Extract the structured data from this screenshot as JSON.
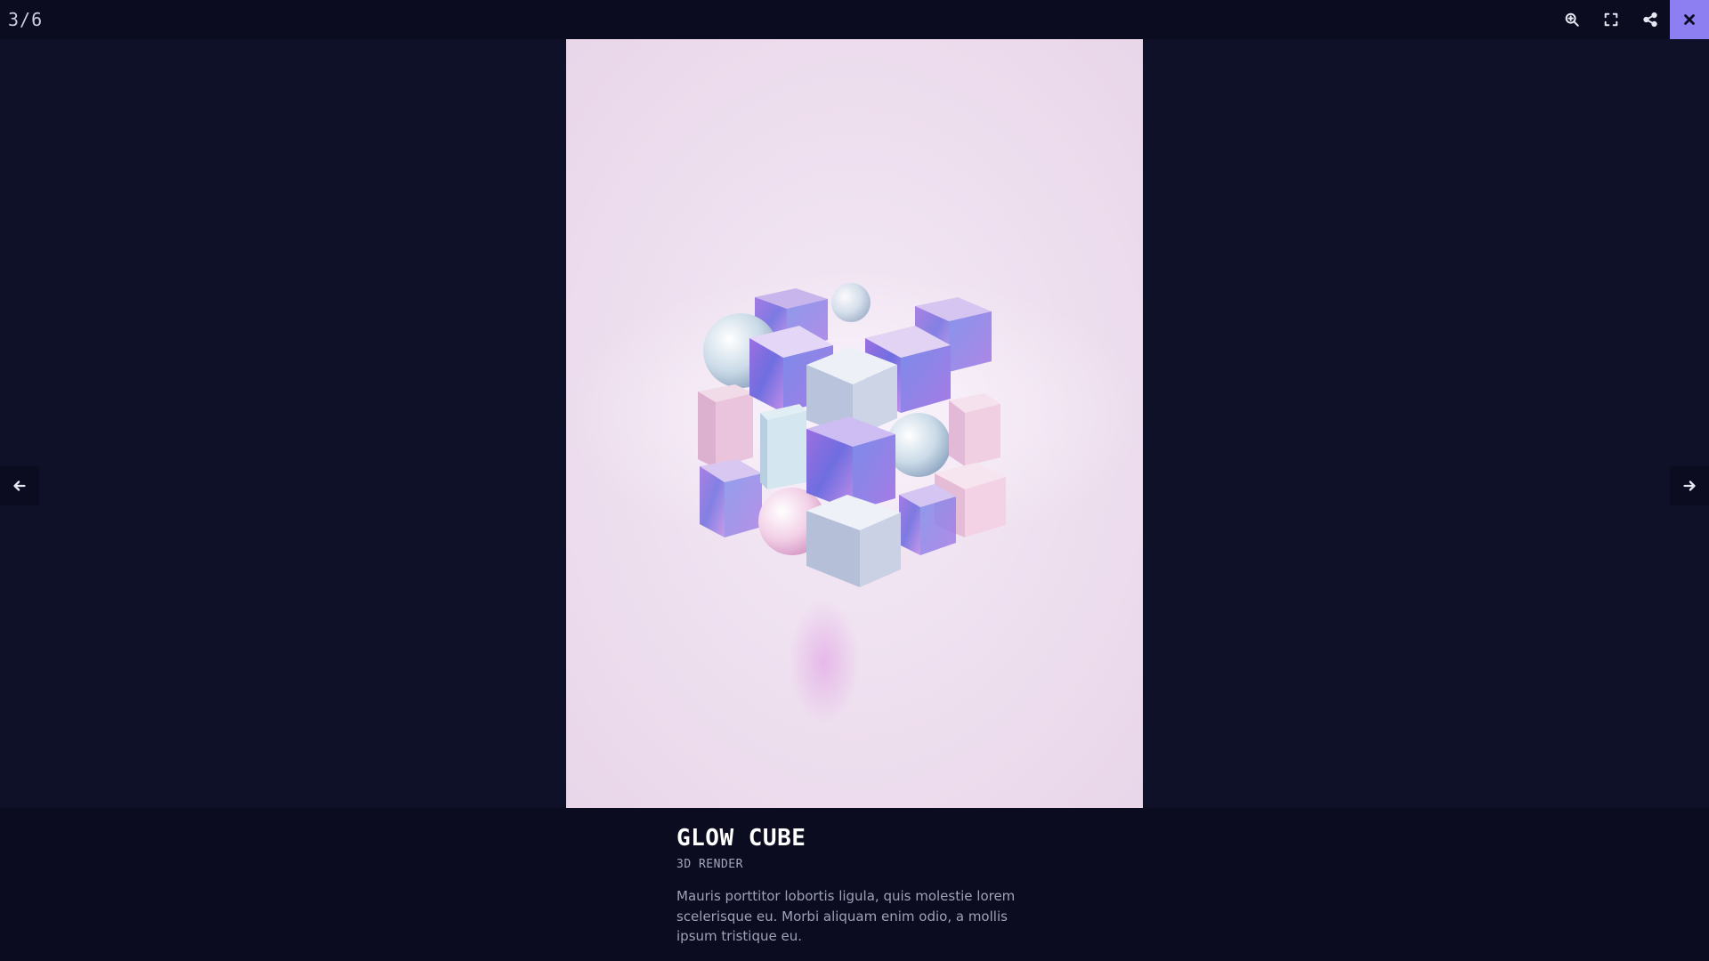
{
  "viewer": {
    "counter": "3/6"
  },
  "toolbar": {
    "icons": [
      "zoom-in-icon",
      "fullscreen-icon",
      "share-icon",
      "close-icon"
    ],
    "close_accent": "#8d7ff2"
  },
  "navigation": {
    "prev_icon": "arrow-left-icon",
    "next_icon": "arrow-right-icon"
  },
  "caption": {
    "title": "GLOW CUBE",
    "category": "3D RENDER",
    "description": "Mauris porttitor lobortis ligula, quis molestie lorem scelerisque eu. Morbi aliquam enim odio, a mollis ipsum tristique eu."
  },
  "colors": {
    "background": "#0f1129",
    "bar": "#0b0c1f",
    "accent": "#8d7ff2"
  }
}
